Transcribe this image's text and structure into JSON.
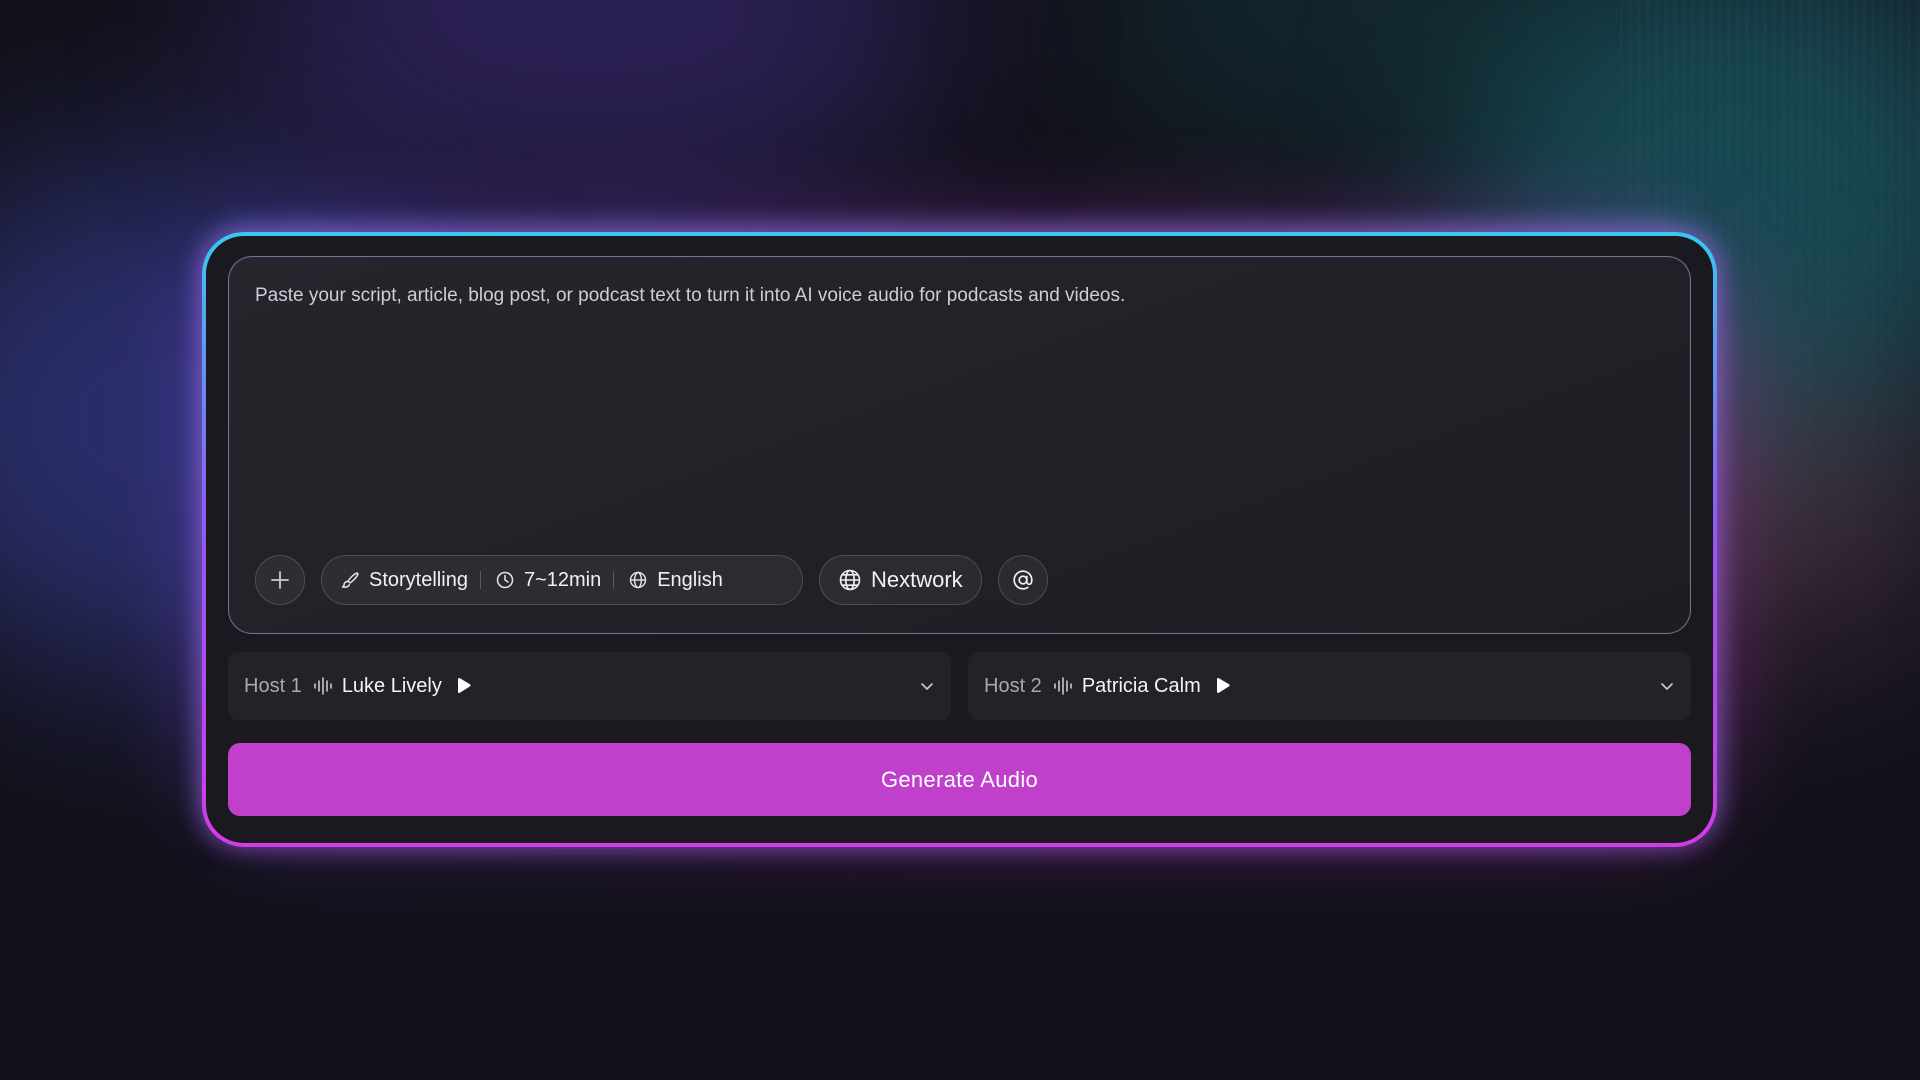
{
  "editor": {
    "placeholder": "Paste your script, article, blog post, or podcast text to turn it into AI voice audio for podcasts and videos.",
    "value": ""
  },
  "toolbar": {
    "add_icon": "plus-icon",
    "style": {
      "icon": "brush-icon",
      "label": "Storytelling"
    },
    "duration": {
      "icon": "clock-icon",
      "label": "7~12min"
    },
    "language": {
      "icon": "globe-icon",
      "label": "English"
    },
    "network": {
      "icon": "globe-grid-icon",
      "label": "Nextwork"
    },
    "mention_icon": "at-icon"
  },
  "hosts": [
    {
      "label": "Host 1",
      "voice_icon": "waveform-icon",
      "voice": "Luke Lively",
      "play_icon": "play-icon",
      "chevron": "chevron-down-icon"
    },
    {
      "label": "Host 2",
      "voice_icon": "waveform-icon",
      "voice": "Patricia Calm",
      "play_icon": "play-icon",
      "chevron": "chevron-down-icon"
    }
  ],
  "actions": {
    "generate_label": "Generate Audio"
  },
  "colors": {
    "accent": "#c040cc",
    "border_top": "#38c8f0",
    "border_bottom": "#d23ce8",
    "panel": "#19191f"
  }
}
